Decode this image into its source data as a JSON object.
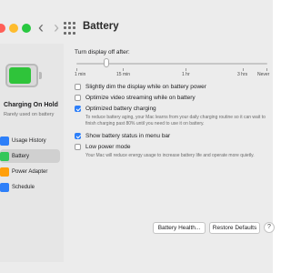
{
  "window": {
    "title": "Battery",
    "back_glyph": "‹",
    "forward_glyph": "›",
    "traffic_colors": [
      "#ff5f57",
      "#febc2e",
      "#28c840"
    ]
  },
  "sidebar": {
    "battery_level": 0.8,
    "battery_color": "#2fc43a",
    "status_title": "Charging On Hold",
    "status_subtitle": "Rarely used on battery",
    "items": [
      {
        "label": "Usage History",
        "icon": "bar-chart-icon",
        "color": "#2d7ff9",
        "active": false
      },
      {
        "label": "Battery",
        "icon": "battery-icon",
        "color": "#34c759",
        "active": true
      },
      {
        "label": "Power Adapter",
        "icon": "power-plug-icon",
        "color": "#ff9f0a",
        "active": false
      },
      {
        "label": "Schedule",
        "icon": "calendar-icon",
        "color": "#2d7ff9",
        "active": false
      }
    ]
  },
  "display_off": {
    "label": "Turn display off after:",
    "value_minutes": 10,
    "tick_labels": [
      "1 min",
      "15 min",
      "1 hr",
      "3 hrs",
      "Never"
    ]
  },
  "options": [
    {
      "label": "Slightly dim the display while on battery power",
      "checked": false,
      "description": ""
    },
    {
      "label": "Optimize video streaming while on battery",
      "checked": false,
      "description": ""
    },
    {
      "label": "Optimized battery charging",
      "checked": true,
      "description": "To reduce battery aging, your Mac learns from your daily charging routine so it can wait to finish charging past 80% until you need to use it on battery."
    },
    {
      "label": "Show battery status in menu bar",
      "checked": true,
      "description": ""
    },
    {
      "label": "Low power mode",
      "checked": false,
      "description": "Your Mac will reduce energy usage to increase battery life and operate more quietly."
    }
  ],
  "buttons": {
    "battery_health": "Battery Health...",
    "restore_defaults": "Restore Defaults",
    "help": "?"
  }
}
